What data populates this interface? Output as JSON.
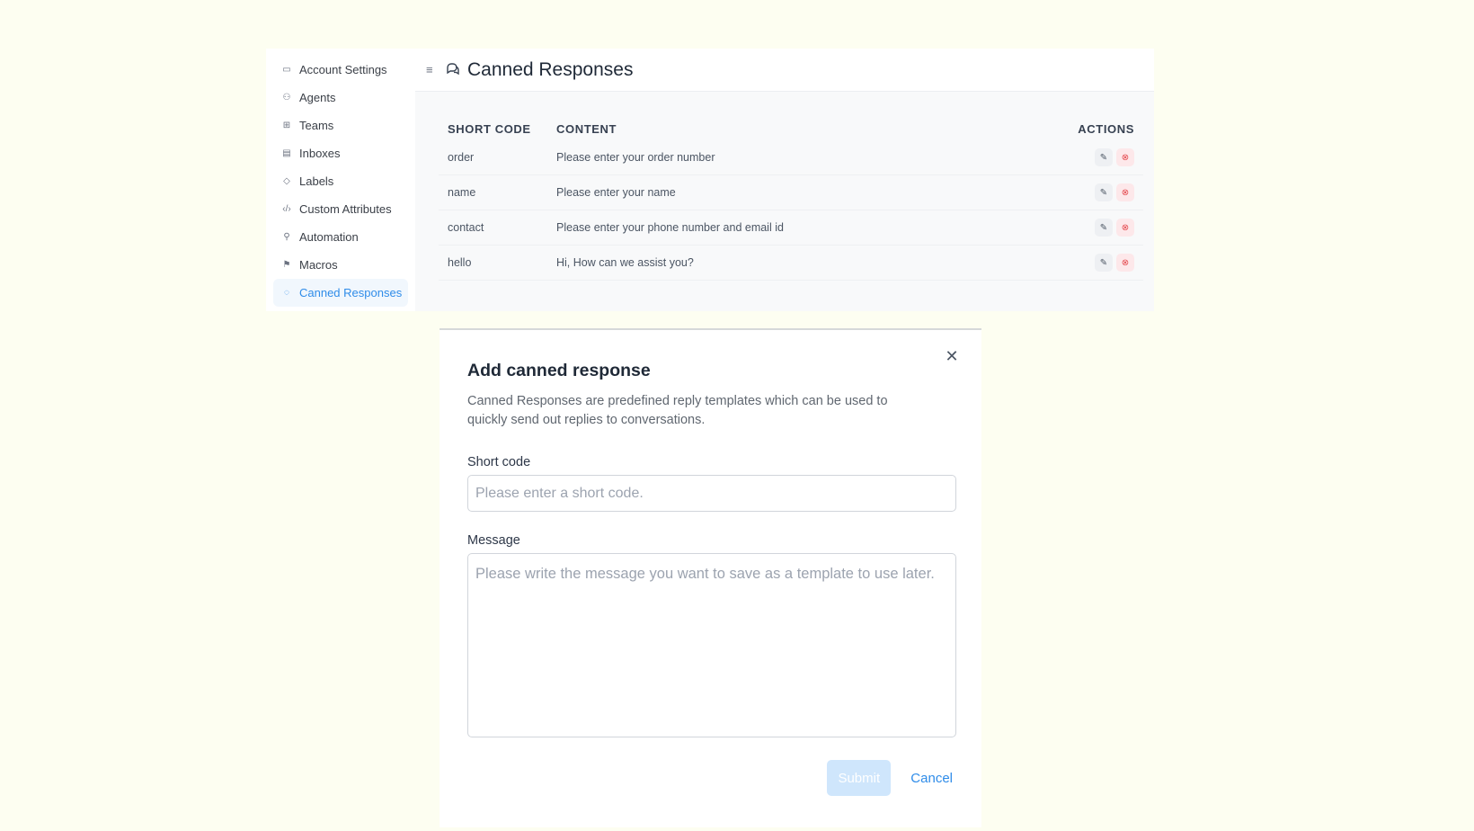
{
  "sidebar": {
    "items": [
      {
        "label": "Account Settings",
        "icon": "briefcase-icon",
        "glyph": "▭",
        "active": false
      },
      {
        "label": "Agents",
        "icon": "people-icon",
        "glyph": "⚇",
        "active": false
      },
      {
        "label": "Teams",
        "icon": "people-team-icon",
        "glyph": "⊞",
        "active": false
      },
      {
        "label": "Inboxes",
        "icon": "inbox-icon",
        "glyph": "▤",
        "active": false
      },
      {
        "label": "Labels",
        "icon": "tag-icon",
        "glyph": "◇",
        "active": false
      },
      {
        "label": "Custom Attributes",
        "icon": "code-icon",
        "glyph": "‹/›",
        "active": false
      },
      {
        "label": "Automation",
        "icon": "automation-icon",
        "glyph": "⚲",
        "active": false
      },
      {
        "label": "Macros",
        "icon": "macros-icon",
        "glyph": "⚑",
        "active": false
      },
      {
        "label": "Canned Responses",
        "icon": "chat-icon",
        "glyph": "◌",
        "active": true
      }
    ]
  },
  "header": {
    "menu_icon": "menu-icon",
    "title_icon": "chat-bubbles-icon",
    "title": "Canned Responses"
  },
  "table": {
    "columns": [
      "SHORT CODE",
      "CONTENT",
      "ACTIONS"
    ],
    "rows": [
      {
        "short_code": "order",
        "content": "Please enter your order number"
      },
      {
        "short_code": "name",
        "content": "Please enter your name"
      },
      {
        "short_code": "contact",
        "content": "Please enter your phone number and email id"
      },
      {
        "short_code": "hello",
        "content": "Hi, How can we assist you?"
      }
    ],
    "edit_icon": "pencil-icon",
    "delete_icon": "dismiss-circle-icon"
  },
  "modal": {
    "title": "Add canned response",
    "description": "Canned Responses are predefined reply templates which can be used to quickly send out replies to conversations.",
    "short_code_label": "Short code",
    "short_code_placeholder": "Please enter a short code.",
    "short_code_value": "",
    "message_label": "Message",
    "message_placeholder": "Please write the message you want to save as a template to use later.",
    "message_value": "",
    "submit_label": "Submit",
    "cancel_label": "Cancel",
    "close_icon": "close-icon"
  },
  "colors": {
    "page_background": "#fdfef1",
    "accent": "#2f8ce9",
    "submit_disabled": "#cfe6fc",
    "delete": "#e5484d"
  }
}
